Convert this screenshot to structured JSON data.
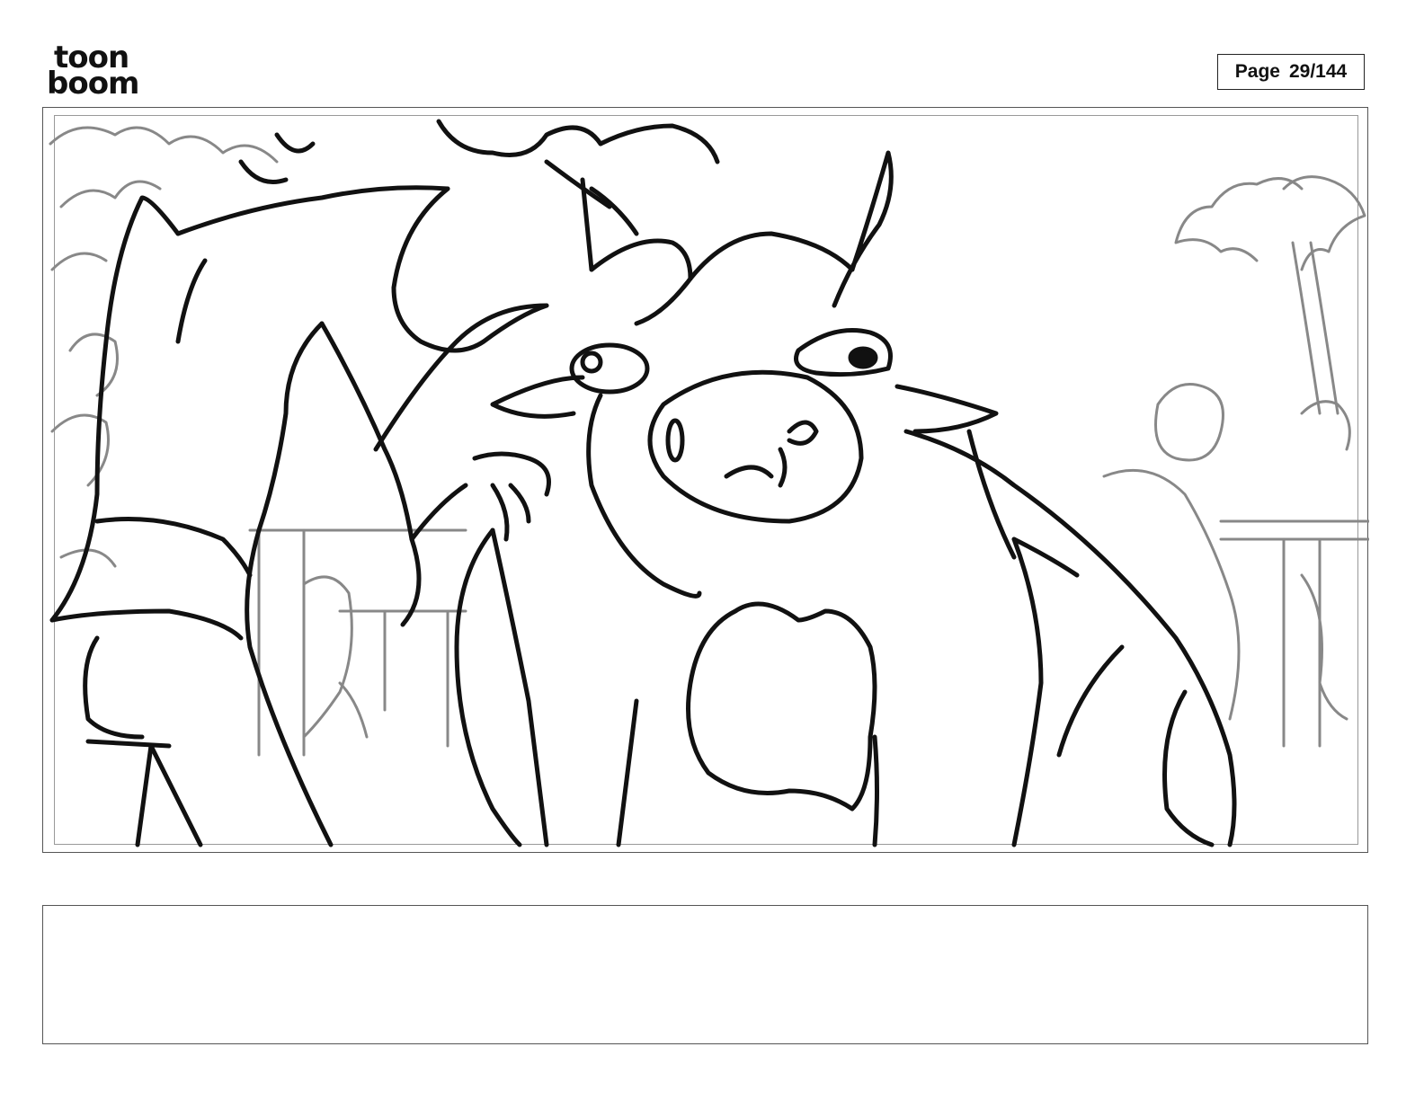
{
  "header": {
    "logo_line1": "toon",
    "logo_line2": "boom",
    "page_label": "Page",
    "page_number": "29/144"
  },
  "panel": {
    "image_description_icon": "storyboard-sketch-image"
  },
  "caption": {
    "text": ""
  }
}
